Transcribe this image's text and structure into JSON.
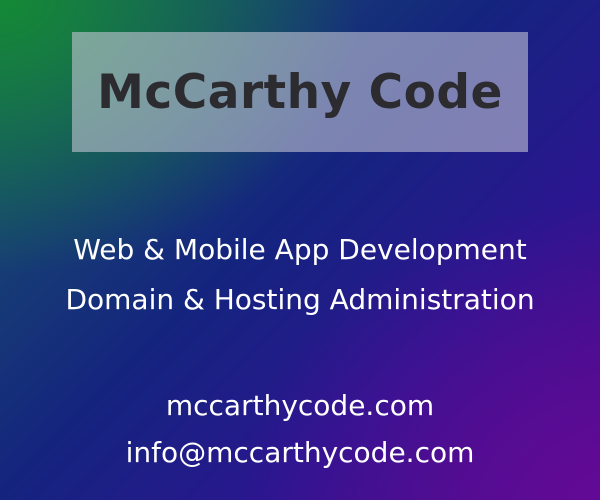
{
  "brand": {
    "name": "McCarthy Code"
  },
  "services": [
    "Web & Mobile App Development",
    "Domain & Hosting Administration"
  ],
  "contact": {
    "website": "mccarthycode.com",
    "email": "info@mccarthycode.com"
  },
  "colors": {
    "banner_text": "#2b2b30",
    "text": "#ffffff",
    "gradient_green": "#148c32",
    "gradient_blue": "#14247e",
    "gradient_purple": "#640a96"
  }
}
